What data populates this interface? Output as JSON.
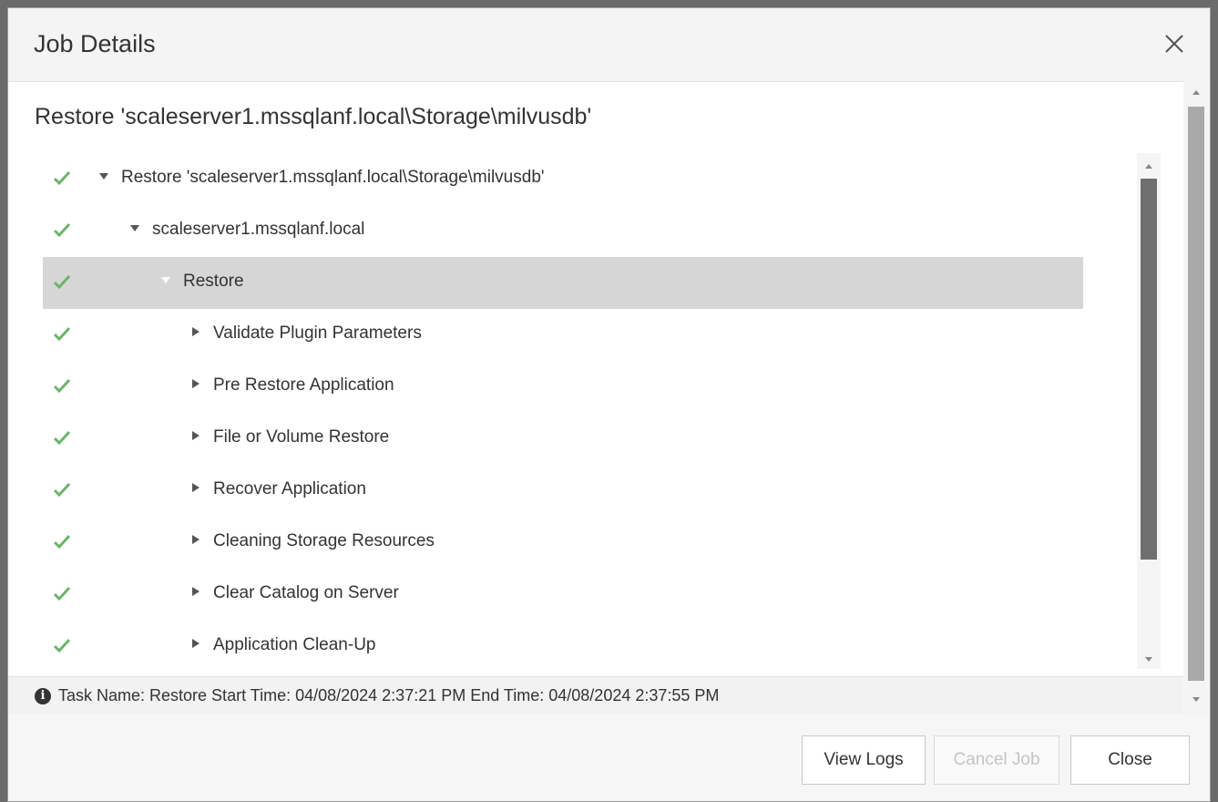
{
  "window": {
    "title": "Job Details"
  },
  "content": {
    "subtitle": "Restore 'scaleserver1.mssqlanf.local\\Storage\\milvusdb'"
  },
  "tree": {
    "rows": [
      {
        "label": "Restore 'scaleserver1.mssqlanf.local\\Storage\\milvusdb'",
        "status": "success",
        "expanded": true
      },
      {
        "label": "scaleserver1.mssqlanf.local",
        "status": "success",
        "expanded": true
      },
      {
        "label": "Restore",
        "status": "success",
        "expanded": true,
        "selected": true
      },
      {
        "label": "Validate Plugin Parameters",
        "status": "success",
        "expanded": false
      },
      {
        "label": "Pre Restore Application",
        "status": "success",
        "expanded": false
      },
      {
        "label": "File or Volume Restore",
        "status": "success",
        "expanded": false
      },
      {
        "label": "Recover Application",
        "status": "success",
        "expanded": false
      },
      {
        "label": "Cleaning Storage Resources",
        "status": "success",
        "expanded": false
      },
      {
        "label": "Clear Catalog on Server",
        "status": "success",
        "expanded": false
      },
      {
        "label": "Application Clean-Up",
        "status": "success",
        "expanded": false
      }
    ]
  },
  "info": {
    "text": "Task Name: Restore Start Time: 04/08/2024 2:37:21 PM End Time: 04/08/2024 2:37:55 PM"
  },
  "buttons": {
    "view_logs": "View Logs",
    "cancel_job": "Cancel Job",
    "close": "Close"
  },
  "colors": {
    "success": "#6cb36b",
    "selected_row": "#d6d6d6"
  }
}
